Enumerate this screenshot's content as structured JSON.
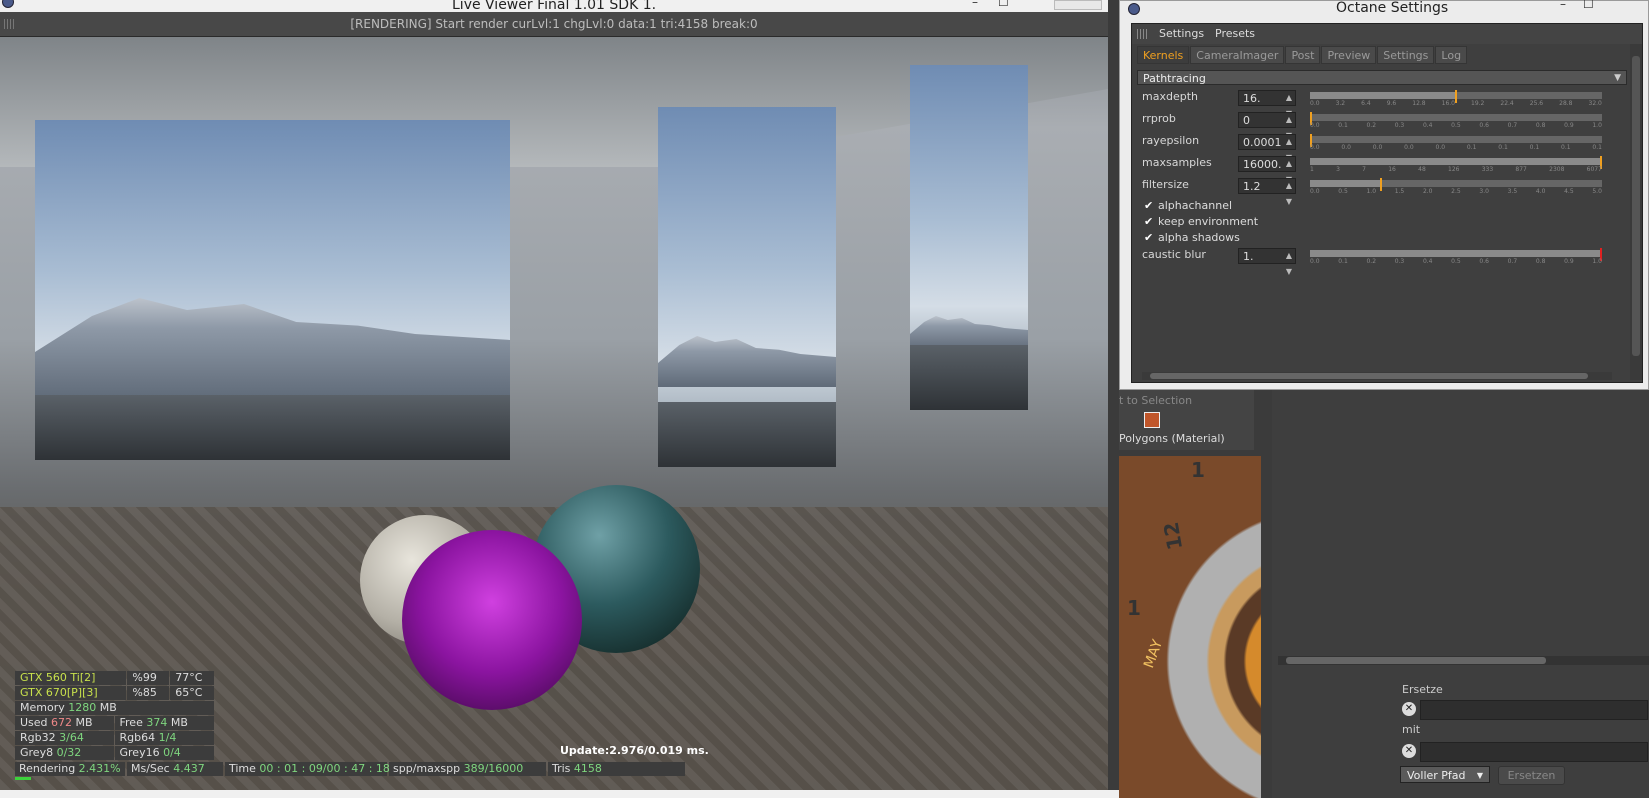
{
  "live_viewer": {
    "title": "Live Viewer Final 1.01   SDK 1.",
    "status_message": "[RENDERING] Start render curLvl:1 chgLvl:0 data:1 tri:4158 break:0",
    "window_buttons": [
      "–",
      "☐"
    ],
    "stats": {
      "gpus": [
        {
          "name": "GTX 560 Ti[2]",
          "load": "%99",
          "temp": "77°C"
        },
        {
          "name": "GTX 670[P][3]",
          "load": "%85",
          "temp": "65°C"
        }
      ],
      "memory_label": "Memory",
      "memory_value": "1280",
      "memory_unit": "MB",
      "used_label": "Used",
      "used_value": "672",
      "used_unit": "MB",
      "free_label": "Free",
      "free_value": "374",
      "free_unit": "MB",
      "rgb32_label": "Rgb32",
      "rgb32_value": "3/64",
      "rgb64_label": "Rgb64",
      "rgb64_value": "1/4",
      "grey8_label": "Grey8",
      "grey8_value": "0/32",
      "grey16_label": "Grey16",
      "grey16_value": "0/4"
    },
    "update_text": "Update:2.976/0.019 ms.",
    "bottom_bar": {
      "rendering_label": "Rendering",
      "rendering_value": "2.431%",
      "mssec_label": "Ms/Sec",
      "mssec_value": "4.437",
      "time_label": "Time",
      "time_value": "00 : 01 : 09/00 : 47 : 18",
      "spp_label": "spp/maxspp",
      "spp_value": "389/16000",
      "tris_label": "Tris",
      "tris_value": "4158"
    },
    "render_progress": 0.02431
  },
  "octane_settings": {
    "title": "Octane Settings",
    "menu": [
      "Settings",
      "Presets"
    ],
    "tabs": [
      "Kernels",
      "CameraImager",
      "Post",
      "Preview",
      "Settings",
      "Log"
    ],
    "active_tab": "Kernels",
    "kernel": "Pathtracing",
    "params": [
      {
        "label": "maxdepth",
        "value": "16.",
        "fraction": 0.5,
        "ticks": [
          "0.0",
          "3.2",
          "6.4",
          "9.6",
          "12.8",
          "16.0",
          "19.2",
          "22.4",
          "25.6",
          "28.8",
          "32.0"
        ]
      },
      {
        "label": "rrprob",
        "value": "0",
        "fraction": 0.0,
        "ticks": [
          "0.0",
          "0.1",
          "0.2",
          "0.3",
          "0.4",
          "0.5",
          "0.6",
          "0.7",
          "0.8",
          "0.9",
          "1.0"
        ]
      },
      {
        "label": "rayepsilon",
        "value": "0.0001",
        "fraction": 0.0,
        "ticks": [
          "0.0",
          "0.0",
          "0.0",
          "0.0",
          "0.0",
          "0.1",
          "0.1",
          "0.1",
          "0.1",
          "0.1"
        ]
      },
      {
        "label": "maxsamples",
        "value": "16000.",
        "fraction": 1.0,
        "ticks": [
          "1",
          "3",
          "7",
          "16",
          "48",
          "126",
          "333",
          "877",
          "2308",
          "6077"
        ]
      },
      {
        "label": "filtersize",
        "value": "1.2",
        "fraction": 0.24,
        "ticks": [
          "0.0",
          "0.5",
          "1.0",
          "1.5",
          "2.0",
          "2.5",
          "3.0",
          "3.5",
          "4.0",
          "4.5",
          "5.0"
        ]
      }
    ],
    "checkboxes": [
      "alphachannel",
      "keep environment",
      "alpha shadows"
    ],
    "caustic": {
      "label": "caustic blur",
      "value": "1.",
      "fraction": 1.0,
      "ticks": [
        "0.0",
        "0.1",
        "0.2",
        "0.3",
        "0.4",
        "0.5",
        "0.6",
        "0.7",
        "0.8",
        "0.9",
        "1.0"
      ]
    }
  },
  "c4d": {
    "selection_label": "t to Selection",
    "polygons_label": "Polygons (Material)",
    "clock_numbers": [
      "1",
      "12",
      "1"
    ],
    "clock_month": "MAY",
    "replace_label": "Ersetze",
    "with_label": "mit",
    "path_select": "Voller Pfad",
    "replace_button": "Ersetzen"
  },
  "colors": {
    "accent": "#f0a020",
    "gpu_name": "#c8e14c",
    "value_green": "#7fd67f",
    "progress": "#3cd23c"
  }
}
